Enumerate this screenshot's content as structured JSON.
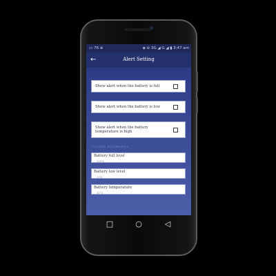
{
  "statusbar": {
    "left_text": "▭  76  ⊕",
    "right_text": "◈ ⊖ 3G ◢ G ◢ ▮ 3:47 am"
  },
  "appbar": {
    "title": "Alert Setting",
    "back_icon": "arrow-left-icon"
  },
  "alerts": [
    {
      "label": "Show alert when the battery is full",
      "checked": false
    },
    {
      "label": "Show alert when the battery is low",
      "checked": false
    },
    {
      "label": "Show alert when the battery temperature is high",
      "checked": false
    }
  ],
  "section_header": "Custom Parameters",
  "fields": [
    {
      "label": "Battery full level",
      "value": "100%"
    },
    {
      "label": "Battery low level",
      "value": "15%"
    },
    {
      "label": "Battery temperature",
      "value": "40°C"
    }
  ],
  "navbar": {
    "recent_icon": "square-icon",
    "home_icon": "circle-icon",
    "back_icon": "triangle-left-icon"
  },
  "colors": {
    "appbar": "#24306c",
    "screen_background": "#2b3a84",
    "card_background": "#ffffff"
  }
}
